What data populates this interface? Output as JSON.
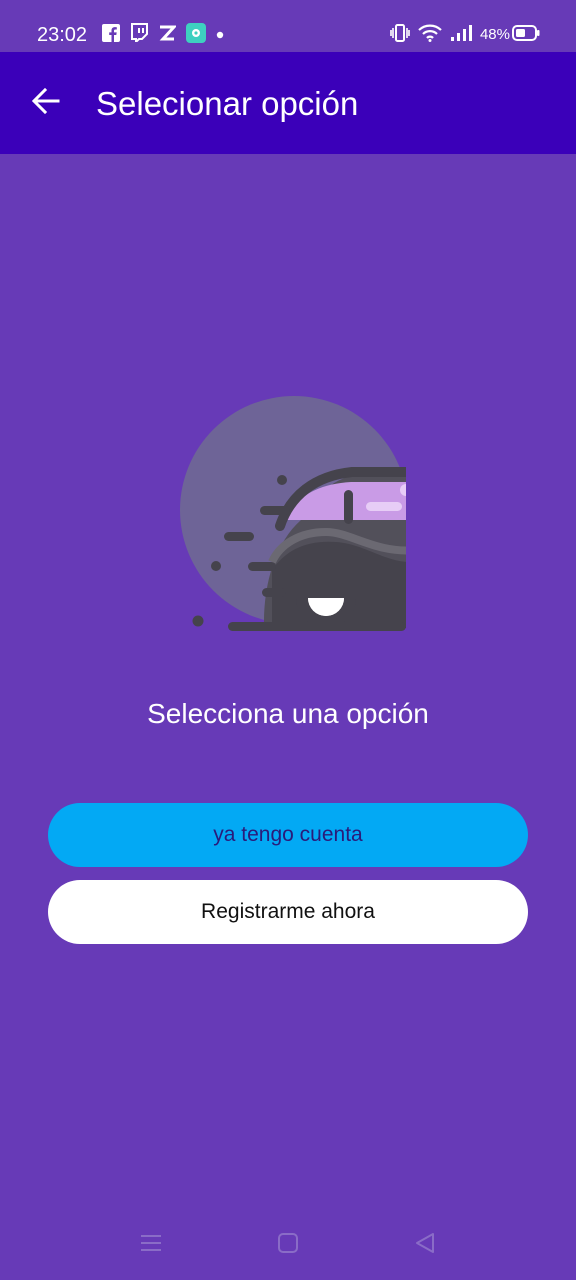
{
  "status_bar": {
    "time": "23:02",
    "battery_percent": "48%",
    "notification_icons": [
      "facebook-icon",
      "twitch-icon",
      "z-icon",
      "app-icon",
      "dot-icon"
    ],
    "system_icons": [
      "vibrate-icon",
      "wifi-icon",
      "signal-icon",
      "battery-icon"
    ]
  },
  "app_bar": {
    "title": "Selecionar opción",
    "back_icon": "arrow-left-icon",
    "background": "#3b00b9"
  },
  "main": {
    "background": "#673ab7",
    "illustration": "car-icon",
    "subtitle": "Selecciona una opción",
    "buttons": {
      "login": "ya tengo cuenta",
      "register": "Registrarme ahora"
    },
    "colors": {
      "login_button": "#03a9f4",
      "register_button": "#ffffff"
    }
  },
  "nav_bar": {
    "icons": [
      "menu-icon",
      "home-square-icon",
      "back-triangle-icon"
    ]
  }
}
